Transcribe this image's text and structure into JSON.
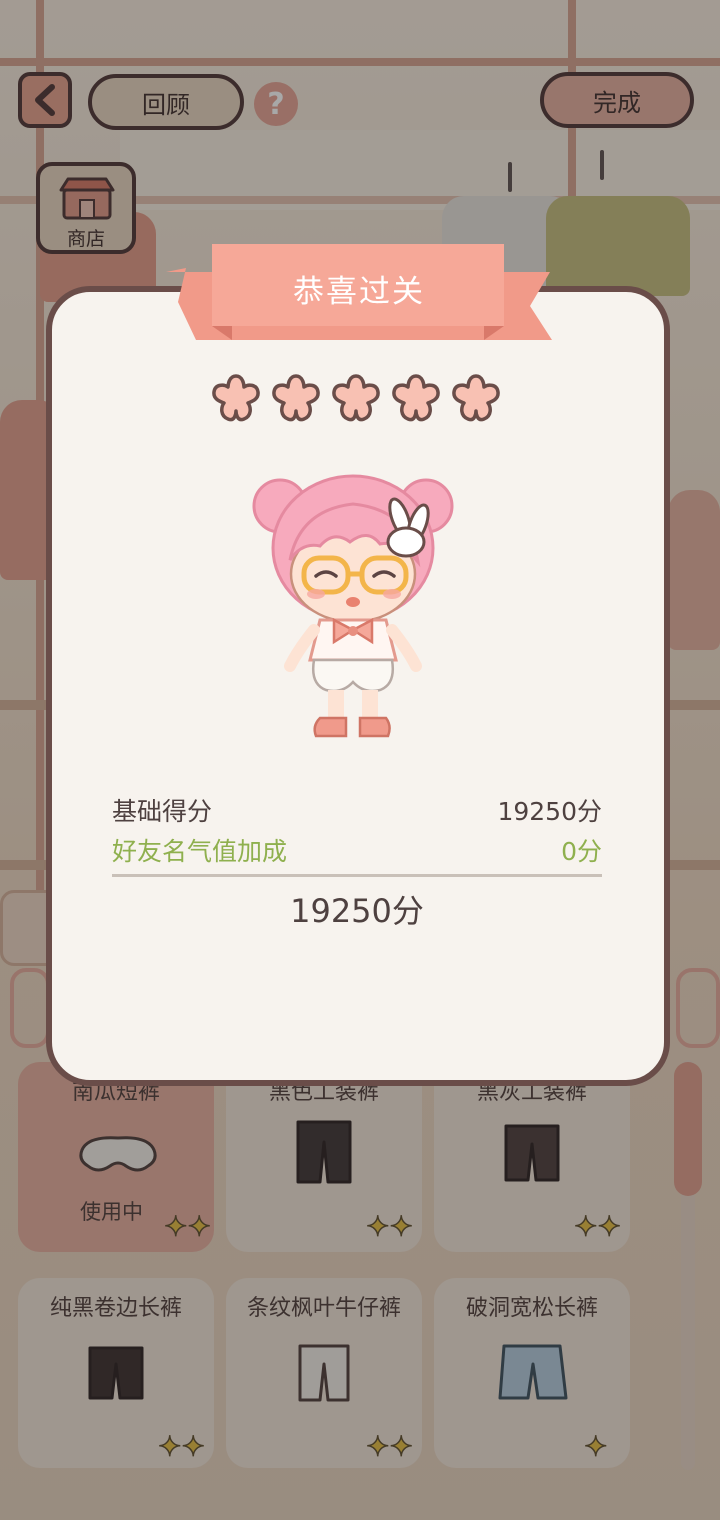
{
  "top_bar": {
    "review_label": "回顾",
    "help_symbol": "?",
    "done_label": "完成"
  },
  "shop": {
    "label": "商店"
  },
  "dialog": {
    "title": "恭喜过关",
    "stars_earned": 5,
    "stars_total": 5,
    "rows": [
      {
        "label": "基础得分",
        "value": "19250分",
        "color": "#4e4140"
      },
      {
        "label": "好友名气值加成",
        "value": "0分",
        "color": "#8fb04e"
      }
    ],
    "total": "19250分"
  },
  "items": [
    {
      "name": "南瓜短裤",
      "status": "使用中",
      "active": true
    },
    {
      "name": "黑色工装裤",
      "status": "",
      "active": false
    },
    {
      "name": "黑灰工装裤",
      "status": "",
      "active": false
    },
    {
      "name": "纯黑卷边长裤",
      "status": "",
      "active": false
    },
    {
      "name": "条纹枫叶牛仔裤",
      "status": "",
      "active": false
    },
    {
      "name": "破洞宽松长裤",
      "status": "",
      "active": false
    }
  ],
  "colors": {
    "accent_pink": "#f4a695",
    "dialog_border": "#6a4d49",
    "bonus_green": "#8fb04e"
  }
}
